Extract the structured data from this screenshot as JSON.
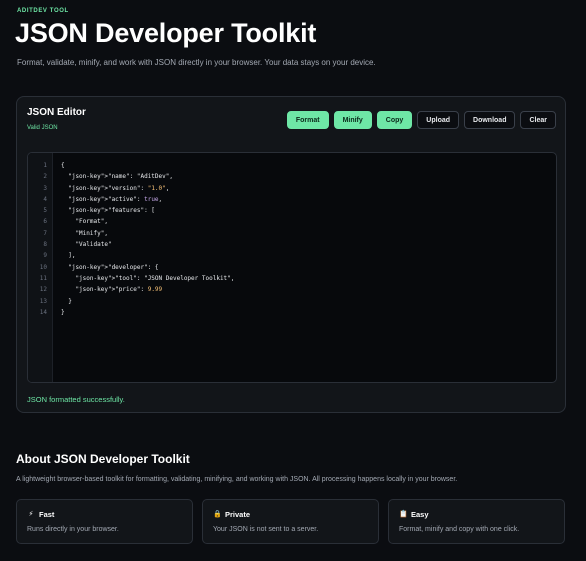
{
  "header": {
    "eyebrow": "ADITDEV TOOL",
    "title": "JSON Developer Toolkit",
    "subtitle": "Format, validate, minify, and work with JSON directly in your browser. Your data stays on your device."
  },
  "editor": {
    "title": "JSON Editor",
    "validity": "Valid JSON",
    "buttons": {
      "format": "Format",
      "minify": "Minify",
      "copy": "Copy",
      "upload": "Upload",
      "download": "Download",
      "clear": "Clear"
    },
    "line_numbers": [
      "1",
      "2",
      "3",
      "4",
      "5",
      "6",
      "7",
      "8",
      "9",
      "10",
      "11",
      "12",
      "13",
      "14"
    ],
    "code_lines": [
      "{",
      "  \"json-key\">\"name\": \"AditDev\",",
      "  \"json-key\">\"version\": \"1.0\",",
      "  \"json-key\">\"active\": true,",
      "  \"json-key\">\"features\": [",
      "    \"Format\",",
      "    \"Minify\",",
      "    \"Validate\"",
      "  ],",
      "  \"json-key\">\"developer\": {",
      "    \"json-key\">\"tool\": \"JSON Developer Toolkit\",",
      "    \"json-key\">\"price\": 9.99",
      "  }",
      "}"
    ],
    "message": "JSON formatted successfully."
  },
  "about": {
    "title": "About JSON Developer Toolkit",
    "description": "A lightweight browser-based toolkit for formatting, validating, minifying, and working with JSON. All processing happens locally in your browser.",
    "features": [
      {
        "icon": "lightning-icon",
        "glyph": "⚡",
        "title": "Fast",
        "description": "Runs directly in your browser."
      },
      {
        "icon": "lock-icon",
        "glyph": "🔒",
        "title": "Private",
        "description": "Your JSON is not sent to a server."
      },
      {
        "icon": "clipboard-icon",
        "glyph": "📋",
        "title": "Easy",
        "description": "Format, minify and copy with one click."
      }
    ]
  },
  "colors": {
    "accent": "#6ee7a6",
    "background": "#0b0d11",
    "card": "#121519"
  }
}
